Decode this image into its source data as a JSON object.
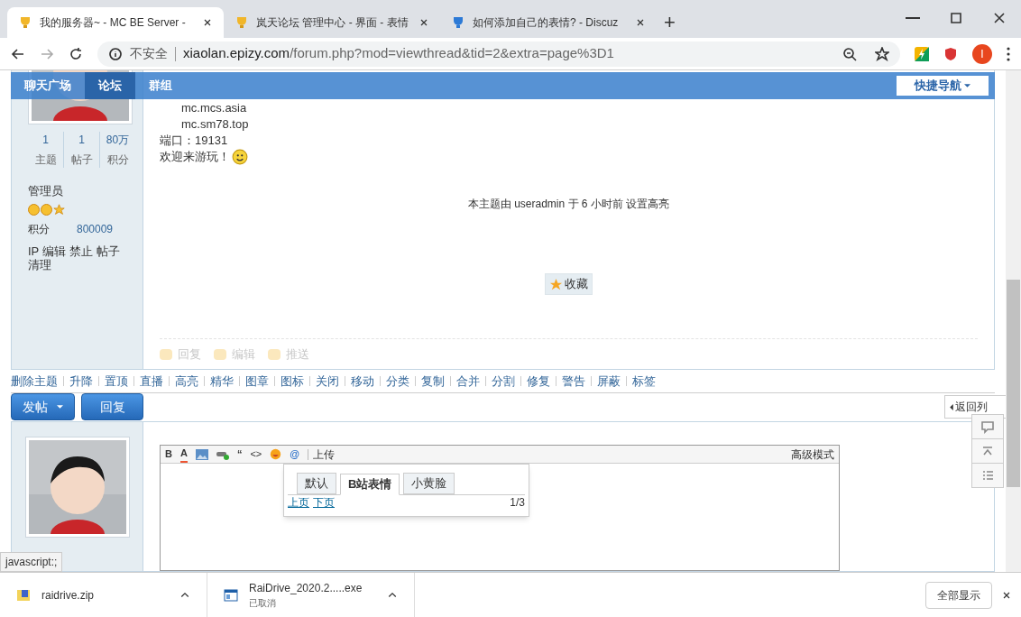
{
  "browser": {
    "tabs": [
      {
        "title": "我的服务器~ - MC BE Server -",
        "selected": true
      },
      {
        "title": "岚天论坛 管理中心 - 界面 - 表情",
        "selected": false
      },
      {
        "title": "如何添加自己的表情? - Discuz",
        "selected": false
      }
    ],
    "new_tab": "+",
    "security": "不安全",
    "url_host": "xiaolan.epizy.com",
    "url_path": "/forum.php?mod=viewthread&tid=2&extra=page%3D1",
    "profile": "I"
  },
  "nav": {
    "items": [
      {
        "label": "聊天广场",
        "selected": false
      },
      {
        "label": "论坛",
        "selected": true
      },
      {
        "label": "群组",
        "selected": false
      }
    ],
    "quick_nav": "快捷导航"
  },
  "author": {
    "stats": [
      {
        "value": "1",
        "label": "主题"
      },
      {
        "value": "1",
        "label": "帖子"
      },
      {
        "value": "80万",
        "label": "积分"
      }
    ],
    "group": "管理员",
    "credit_label": "积分",
    "credit_value": "800009",
    "admin_links": [
      "IP",
      "编辑",
      "禁止",
      "帖子",
      "清理"
    ]
  },
  "post": {
    "lines": [
      {
        "text": "mc.mcs.asia",
        "kind": "indented"
      },
      {
        "text": "mc.sm78.top",
        "kind": "indented"
      },
      {
        "text": "端口：19131",
        "kind": "plain"
      },
      {
        "text": "欢迎来游玩！",
        "kind": "smiley"
      }
    ],
    "notice": "本主题由 useradmin 于 6 小时前 设置高亮",
    "favorite": "收藏",
    "actions": [
      "回复",
      "编辑",
      "推送"
    ]
  },
  "mod_actions": [
    "删除主题",
    "升降",
    "置顶",
    "直播",
    "高亮",
    "精华",
    "图章",
    "图标",
    "关闭",
    "移动",
    "分类",
    "复制",
    "合并",
    "分割",
    "修复",
    "警告",
    "屏蔽",
    "标签"
  ],
  "buttons": {
    "post": "发帖",
    "reply": "回复",
    "back": "返回列"
  },
  "editor": {
    "tools": [
      "B",
      "A",
      "“",
      "<>",
      "@"
    ],
    "upload": "上传",
    "advanced": "高级模式",
    "smiley_tabs": [
      {
        "label": "默认",
        "selected": false
      },
      {
        "label": "B站表情",
        "selected": true
      },
      {
        "label": "小黄脸",
        "selected": false
      }
    ],
    "prev": "上页",
    "next": "下页",
    "page": "1/3"
  },
  "status_url": "javascript:;",
  "downloads": [
    {
      "name": "raidrive.zip",
      "kind": "zip"
    },
    {
      "name": "RaiDrive_2020.2.....exe",
      "status": "已取消",
      "kind": "exe"
    }
  ],
  "show_all": "全部显示"
}
